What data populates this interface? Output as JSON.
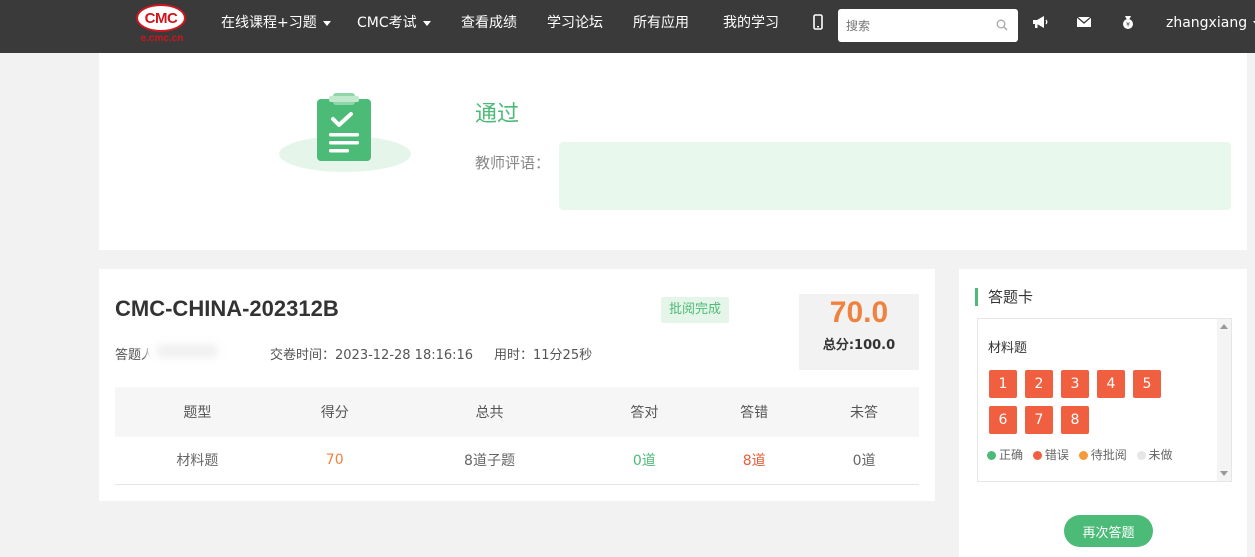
{
  "nav": {
    "logo_text": "CMC",
    "logo_sub": "e.cmc.cn",
    "items": [
      {
        "label": "在线课程+习题",
        "dropdown": true
      },
      {
        "label": "CMC考试",
        "dropdown": true
      },
      {
        "label": "查看成绩"
      },
      {
        "label": "学习论坛"
      },
      {
        "label": "所有应用"
      },
      {
        "label": "我的学习"
      }
    ],
    "search_placeholder": "搜索",
    "username": "zhangxiang"
  },
  "result": {
    "status": "通过",
    "comment_label": "教师评语："
  },
  "exam": {
    "title": "CMC-CHINA-202312B",
    "status_badge": "批阅完成",
    "respondent_label": "答题人",
    "submit_time": "交卷时间：2023-12-28 18:16:16",
    "duration": "用时：11分25秒",
    "score": "70.0",
    "total": "总分:100.0",
    "table": {
      "headers": [
        "题型",
        "得分",
        "总共",
        "答对",
        "答错",
        "未答"
      ],
      "row": [
        "材料题",
        "70",
        "8道子题",
        "0道",
        "8道",
        "0道"
      ]
    }
  },
  "sheet": {
    "title": "答题卡",
    "section": "材料题",
    "questions": [
      "1",
      "2",
      "3",
      "4",
      "5",
      "6",
      "7",
      "8"
    ],
    "legend": [
      {
        "label": "正确",
        "color": "#4cbb77"
      },
      {
        "label": "错误",
        "color": "#f06040"
      },
      {
        "label": "待批阅",
        "color": "#f59a3c"
      },
      {
        "label": "未做",
        "color": "#e6e6e6"
      }
    ],
    "retry_label": "再次答题"
  },
  "colors": {
    "accent_green": "#4cbb77",
    "score_orange": "#f08240",
    "wrong_red": "#f06040",
    "nav_bg": "#3a3a3a"
  }
}
